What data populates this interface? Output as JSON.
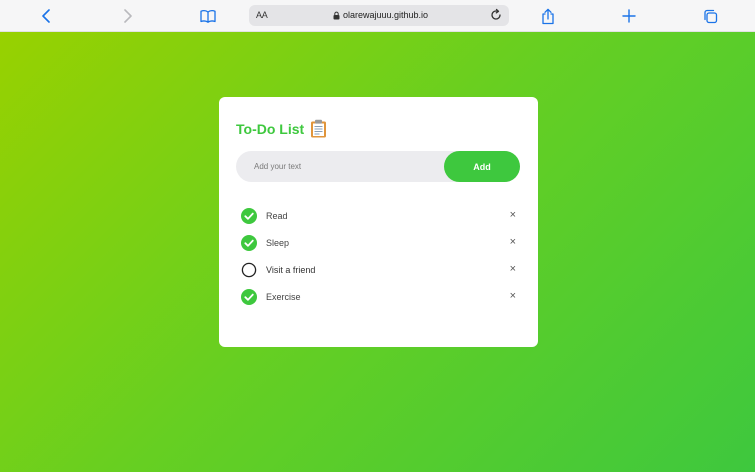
{
  "browser": {
    "aa_label": "AA",
    "domain": "olarewajuuu.github.io"
  },
  "app": {
    "title": "To-Do List",
    "title_icon": "clipboard-icon",
    "input_placeholder": "Add your text",
    "input_value": "",
    "add_label": "Add",
    "remove_label": "×",
    "accent_color": "#3ec83e",
    "tasks": [
      {
        "label": "Read",
        "done": true
      },
      {
        "label": "Sleep",
        "done": true
      },
      {
        "label": "Visit a friend",
        "done": false
      },
      {
        "label": "Exercise",
        "done": true
      }
    ]
  }
}
